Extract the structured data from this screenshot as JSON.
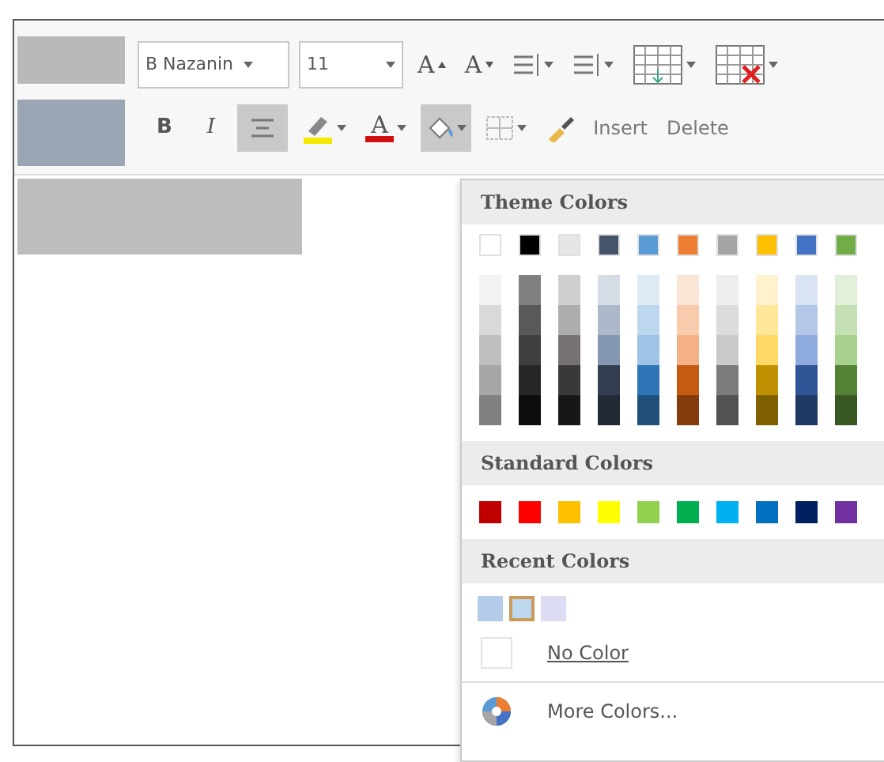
{
  "toolbar": {
    "font_name": "B Nazanin",
    "font_size": "11",
    "row1": [
      {
        "kind": "grow",
        "glyph": "A"
      },
      {
        "kind": "shrink",
        "glyph": "A"
      },
      {
        "kind": "bullets"
      },
      {
        "kind": "numbering"
      },
      {
        "kind": "table-insert"
      },
      {
        "kind": "table-delete"
      }
    ],
    "row2": [
      {
        "kind": "bold",
        "glyph": "B",
        "selected": false
      },
      {
        "kind": "italic",
        "glyph": "I",
        "selected": false
      },
      {
        "kind": "center",
        "selected": true
      },
      {
        "kind": "highlight",
        "selected": false
      },
      {
        "kind": "font-color",
        "glyph": "A",
        "selected": false
      },
      {
        "kind": "shading",
        "selected": true
      },
      {
        "kind": "borders",
        "selected": false
      },
      {
        "kind": "painter",
        "selected": false
      },
      {
        "kind": "text",
        "label": "Insert",
        "selected": false
      },
      {
        "kind": "text",
        "label": "Delete",
        "selected": false
      }
    ]
  },
  "color_menu": {
    "theme_title": "Theme Colors",
    "theme_colors": [
      {
        "color": "#ffffff",
        "shades": [
          {
            "color": "#f2f2f2"
          },
          {
            "color": "#d9d9d9"
          },
          {
            "color": "#bfbfbf"
          },
          {
            "color": "#a6a6a6"
          },
          {
            "color": "#808080"
          }
        ]
      },
      {
        "color": "#000000",
        "shades": [
          {
            "color": "#808080"
          },
          {
            "color": "#595959"
          },
          {
            "color": "#404040"
          },
          {
            "color": "#262626"
          },
          {
            "color": "#0d0d0d"
          }
        ]
      },
      {
        "color": "#e7e6e6",
        "shades": [
          {
            "color": "#d0cece"
          },
          {
            "color": "#aeabab"
          },
          {
            "color": "#757171"
          },
          {
            "color": "#3b3838"
          },
          {
            "color": "#181717"
          }
        ]
      },
      {
        "color": "#44546a",
        "shades": [
          {
            "color": "#d6dce5"
          },
          {
            "color": "#adb9ca"
          },
          {
            "color": "#8497b0"
          },
          {
            "color": "#333f50"
          },
          {
            "color": "#222a35"
          }
        ]
      },
      {
        "color": "#5b9bd5",
        "shades": [
          {
            "color": "#deebf7"
          },
          {
            "color": "#bdd7ee"
          },
          {
            "color": "#9dc3e6"
          },
          {
            "color": "#2e75b6"
          },
          {
            "color": "#1f4e79"
          }
        ]
      },
      {
        "color": "#ed7d31",
        "shades": [
          {
            "color": "#fbe5d6"
          },
          {
            "color": "#f8cbad"
          },
          {
            "color": "#f4b183"
          },
          {
            "color": "#c55a11"
          },
          {
            "color": "#843c0c"
          }
        ]
      },
      {
        "color": "#a5a5a5",
        "shades": [
          {
            "color": "#ededed"
          },
          {
            "color": "#dbdbdb"
          },
          {
            "color": "#c9c9c9"
          },
          {
            "color": "#7b7b7b"
          },
          {
            "color": "#525252"
          }
        ]
      },
      {
        "color": "#ffc000",
        "shades": [
          {
            "color": "#fff2cc"
          },
          {
            "color": "#ffe699"
          },
          {
            "color": "#ffd966"
          },
          {
            "color": "#bf9000"
          },
          {
            "color": "#7f6000"
          }
        ]
      },
      {
        "color": "#4472c4",
        "shades": [
          {
            "color": "#dae3f3"
          },
          {
            "color": "#b4c7e7"
          },
          {
            "color": "#8faadc"
          },
          {
            "color": "#2f5597"
          },
          {
            "color": "#203864"
          }
        ]
      },
      {
        "color": "#70ad47",
        "shades": [
          {
            "color": "#e2f0d9"
          },
          {
            "color": "#c5e0b4"
          },
          {
            "color": "#a9d18e"
          },
          {
            "color": "#548235"
          },
          {
            "color": "#385723"
          }
        ]
      }
    ],
    "standard_title": "Standard Colors",
    "standard_colors": [
      {
        "color": "#c00000"
      },
      {
        "color": "#ff0000"
      },
      {
        "color": "#ffc000"
      },
      {
        "color": "#ffff00"
      },
      {
        "color": "#92d050"
      },
      {
        "color": "#00b050"
      },
      {
        "color": "#00b0f0"
      },
      {
        "color": "#0070c0"
      },
      {
        "color": "#002060"
      },
      {
        "color": "#7030a0"
      }
    ],
    "recent_title": "Recent Colors",
    "recent_colors": [
      {
        "color": "#b4cce8",
        "selected": false
      },
      {
        "color": "#bdd7ee",
        "selected": true
      },
      {
        "color": "#dcdcf2",
        "selected": false
      }
    ],
    "no_color": "No Color",
    "more_colors": "More Colors..."
  }
}
